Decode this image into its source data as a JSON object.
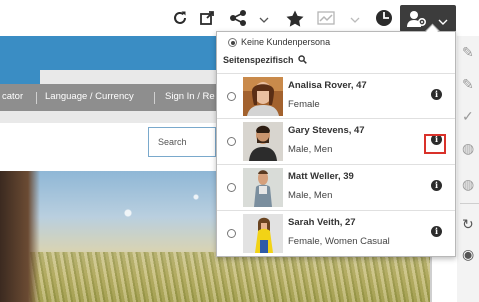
{
  "toolbar": {
    "icons": [
      "refresh-icon",
      "external-link-icon",
      "share-icon",
      "star-icon",
      "chart-icon",
      "clock-icon",
      "persona-icon"
    ]
  },
  "site": {
    "nav_links": [
      "cator",
      "Language / Currency",
      "Sign In / Re"
    ],
    "search_placeholder": "Search"
  },
  "dropdown": {
    "no_persona_label": "Keine Kundenpersona",
    "page_specific_label": "Seitenspezifisch",
    "personas": [
      {
        "name": "Analisa Rover, 47",
        "desc": "Female",
        "selected": false
      },
      {
        "name": "Gary Stevens, 47",
        "desc": "Male, Men",
        "selected": false
      },
      {
        "name": "Matt Weller, 39",
        "desc": "Male, Men",
        "selected": false
      },
      {
        "name": "Sarah Veith, 27",
        "desc": "Female, Women Casual",
        "selected": false
      }
    ]
  },
  "colors": {
    "site_blue": "#3a8dc4",
    "highlight_red": "#d9312a",
    "persona_button": "#3c3c3c"
  }
}
